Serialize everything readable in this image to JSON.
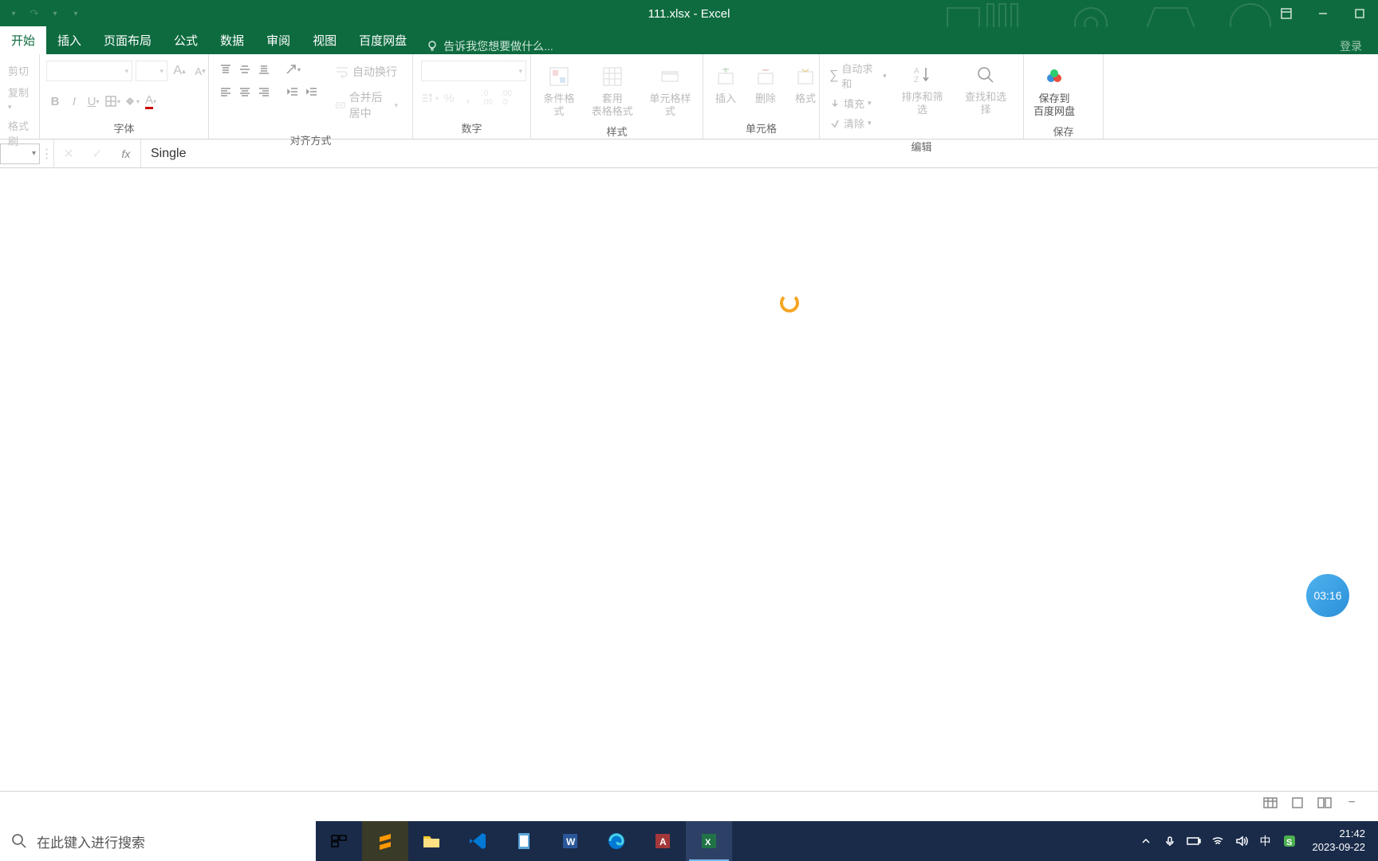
{
  "title": "111.xlsx - Excel",
  "login_label": "登录",
  "qat": {
    "undo": "↶",
    "redo": "↷"
  },
  "tabs": [
    "开始",
    "插入",
    "页面布局",
    "公式",
    "数据",
    "审阅",
    "视图",
    "百度网盘"
  ],
  "active_tab_index": 0,
  "tell_me": "告诉我您想要做什么...",
  "clipboard": {
    "cut": "剪切",
    "copy": "复制",
    "painter": "格式刷"
  },
  "groups": {
    "font": "字体",
    "alignment": "对齐方式",
    "number": "数字",
    "styles": "样式",
    "cells": "单元格",
    "editing": "编辑",
    "save": "保存"
  },
  "font": {
    "name": "",
    "size": "",
    "grow": "A",
    "shrink": "A"
  },
  "alignment": {
    "wrap": "自动换行",
    "merge": "合并后居中"
  },
  "number": {
    "format": ""
  },
  "styles": {
    "conditional": "条件格式",
    "table": "套用\n表格格式",
    "cell": "单元格样式"
  },
  "cells": {
    "insert": "插入",
    "delete": "删除",
    "format": "格式"
  },
  "editing": {
    "autosum": "自动求和",
    "fill": "填充",
    "clear": "清除",
    "sort": "排序和筛选",
    "find": "查找和选择"
  },
  "baidu": {
    "save": "保存到\n百度网盘"
  },
  "formula_bar": {
    "name_box": "",
    "fx": "fx",
    "value": "Single"
  },
  "timer": "03:16",
  "search_placeholder": "在此键入进行搜索",
  "clock": {
    "time": "21:42",
    "date": "2023-09-22"
  },
  "ime": "中"
}
